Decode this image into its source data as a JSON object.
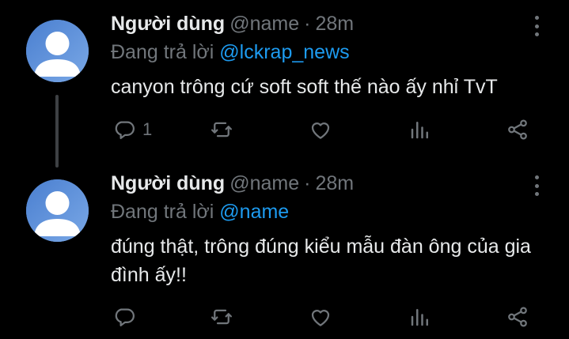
{
  "tweets": [
    {
      "name": "Người dùng",
      "handle": "@name",
      "dot": "·",
      "time": "28m",
      "reply_prefix": "Đang trả lời",
      "reply_to": "@lckrap_news",
      "text": "canyon trông cứ soft soft thế nào ấy nhỉ TvT",
      "reply_count": "1"
    },
    {
      "name": "Người dùng",
      "handle": "@name",
      "dot": "·",
      "time": "28m",
      "reply_prefix": "Đang trả lời",
      "reply_to": "@name",
      "text": "đúng thật, trông đúng kiểu mẫu đàn ông của gia đình ấy!!",
      "reply_count": ""
    }
  ],
  "icons": [
    "reply-icon",
    "retweet-icon",
    "like-icon",
    "analytics-icon",
    "share-icon",
    "more-icon"
  ],
  "colors": {
    "background": "#000000",
    "text": "#e7e9ea",
    "muted": "#71767b",
    "link": "#1d9bf0",
    "avatar": "#5b8fd6"
  }
}
